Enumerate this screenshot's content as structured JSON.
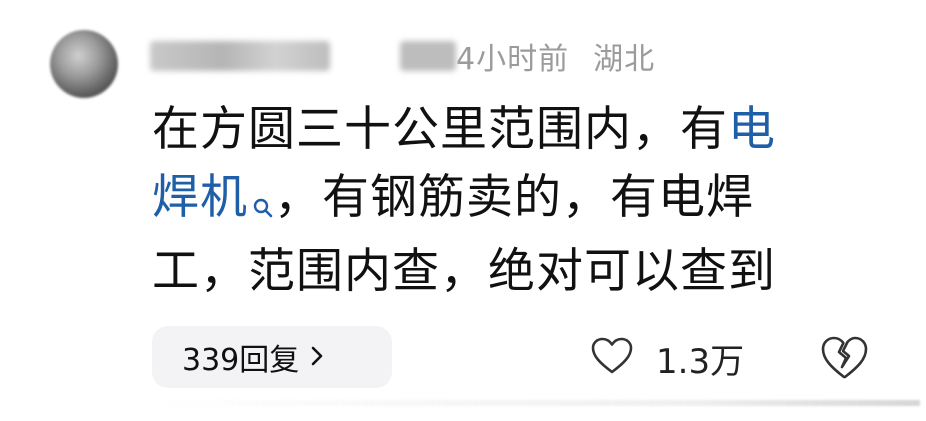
{
  "comment": {
    "time_visible": "4小时前",
    "location": "湖北",
    "text_parts": {
      "p1": "在方圆三十公里范围内，有",
      "link1": "电",
      "link2": "焊机",
      "p2": "，有钢筋卖的，有电焊",
      "p3": "工，范围内查，绝对可以查到"
    },
    "replies_label": "339回复",
    "like_count": "1.3万"
  },
  "icons": {
    "search": "search-icon",
    "chevron": "chevron-right-icon",
    "like": "heart-icon",
    "dislike": "broken-heart-icon"
  },
  "colors": {
    "link": "#1f5fa8",
    "meta": "#9b9b9b",
    "text": "#111111",
    "pill_bg": "#f3f3f5"
  }
}
